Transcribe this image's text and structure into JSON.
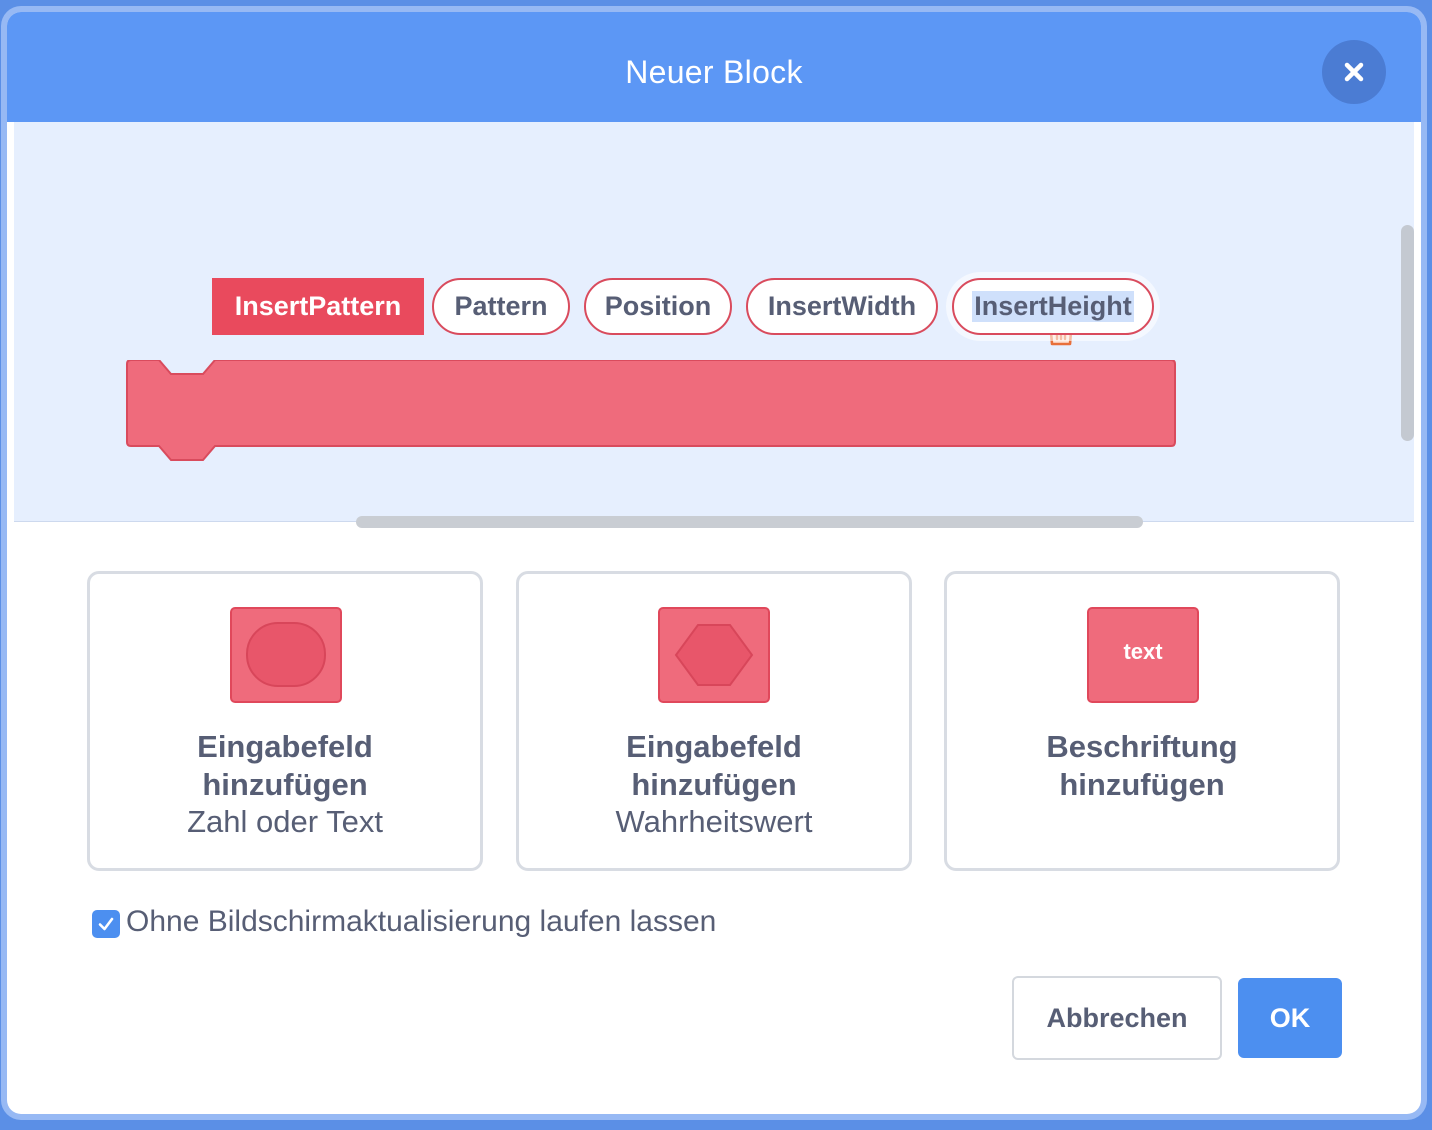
{
  "dialog": {
    "title": "Neuer Block",
    "close_icon": "close-icon"
  },
  "colors": {
    "header": "#5c97f5",
    "workspace": "#e6effe",
    "block": "#ef6b7c",
    "block_dark": "#e94a5d",
    "primary_button": "#4c8ff0",
    "trash": "#e86f3a"
  },
  "block": {
    "name": "InsertPattern",
    "arguments": [
      "Pattern",
      "Position",
      "InsertWidth",
      "InsertHeight"
    ],
    "selected_argument": "InsertHeight",
    "delete_icon": "trash-icon"
  },
  "options": [
    {
      "title_line1": "Eingabefeld",
      "title_line2": "hinzufügen",
      "subtitle": "Zahl oder Text",
      "icon": "round-input-icon"
    },
    {
      "title_line1": "Eingabefeld",
      "title_line2": "hinzufügen",
      "subtitle": "Wahrheitswert",
      "icon": "boolean-input-icon"
    },
    {
      "title_line1": "Beschriftung",
      "title_line2": "hinzufügen",
      "icon_text": "text",
      "icon": "label-icon"
    }
  ],
  "run_without_refresh": {
    "label": "Ohne Bildschirmaktualisierung laufen lassen",
    "checked": true
  },
  "buttons": {
    "cancel": "Abbrechen",
    "ok": "OK"
  }
}
